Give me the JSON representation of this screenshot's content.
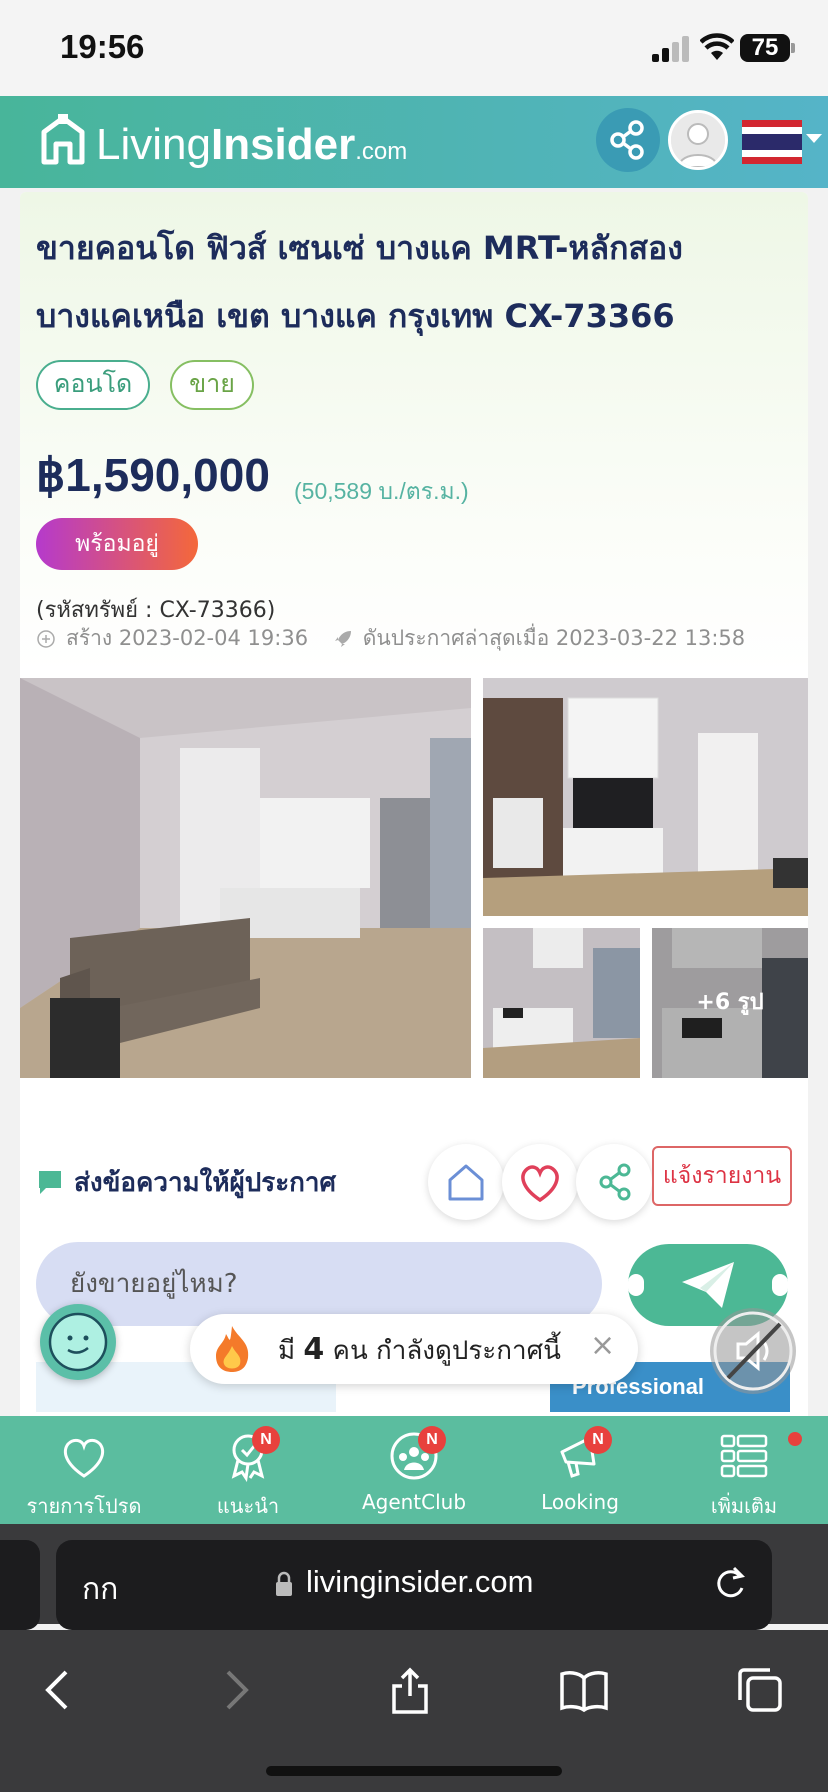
{
  "status_bar": {
    "time": "19:56",
    "battery": "75"
  },
  "header": {
    "logo_word1": "Living",
    "logo_word2": "Insider",
    "logo_suffix": ".com",
    "share_icon": "share-icon",
    "avatar_icon": "user-avatar-icon",
    "flag_icon": "thailand-flag-icon"
  },
  "listing": {
    "title": "ขายคอนโด ฟิวส์ เซนเซ่ บางแค MRT-หลักสอง บางแคเหนือ เขต บางแค กรุงเทพ CX-73366",
    "tags": [
      "คอนโด",
      "ขาย"
    ],
    "price": "฿1,590,000",
    "price_per_sqm": "(50,589 บ./ตร.ม.)",
    "status_badge": "พร้อมอยู่",
    "property_code": "(รหัสทรัพย์ : CX-73366)",
    "created": "สร้าง 2023-02-04 19:36",
    "bumped": "ดันประกาศล่าสุดเมื่อ 2023-03-22 13:58"
  },
  "gallery": {
    "more_label": "+6 รูป"
  },
  "message": {
    "title": "ส่งข้อความให้ผู้ประกาศ",
    "report_label": "แจ้งรายงาน",
    "input_value": "ยังขายอยู่ไหม?",
    "pro_label": "Professional"
  },
  "viewers": {
    "prefix": "มี",
    "count": "4",
    "suffix": "คน กำลังดูประกาศนี้",
    "close": "×"
  },
  "tabbar": [
    {
      "label": "รายการโปรด",
      "icon": "heart-icon",
      "badge": ""
    },
    {
      "label": "แนะนำ",
      "icon": "award-ribbon-icon",
      "badge": "N"
    },
    {
      "label": "AgentClub",
      "icon": "agent-group-icon",
      "badge": "N"
    },
    {
      "label": "Looking",
      "icon": "megaphone-icon",
      "badge": "N"
    },
    {
      "label": "เพิ่มเติม",
      "icon": "menu-list-icon",
      "badge": ""
    }
  ],
  "browser": {
    "aa_label": "กก",
    "url": "livinginsider.com"
  },
  "colors": {
    "brand_green": "#48b59a",
    "navy": "#1d2c5b",
    "send_green": "#4cb895"
  }
}
